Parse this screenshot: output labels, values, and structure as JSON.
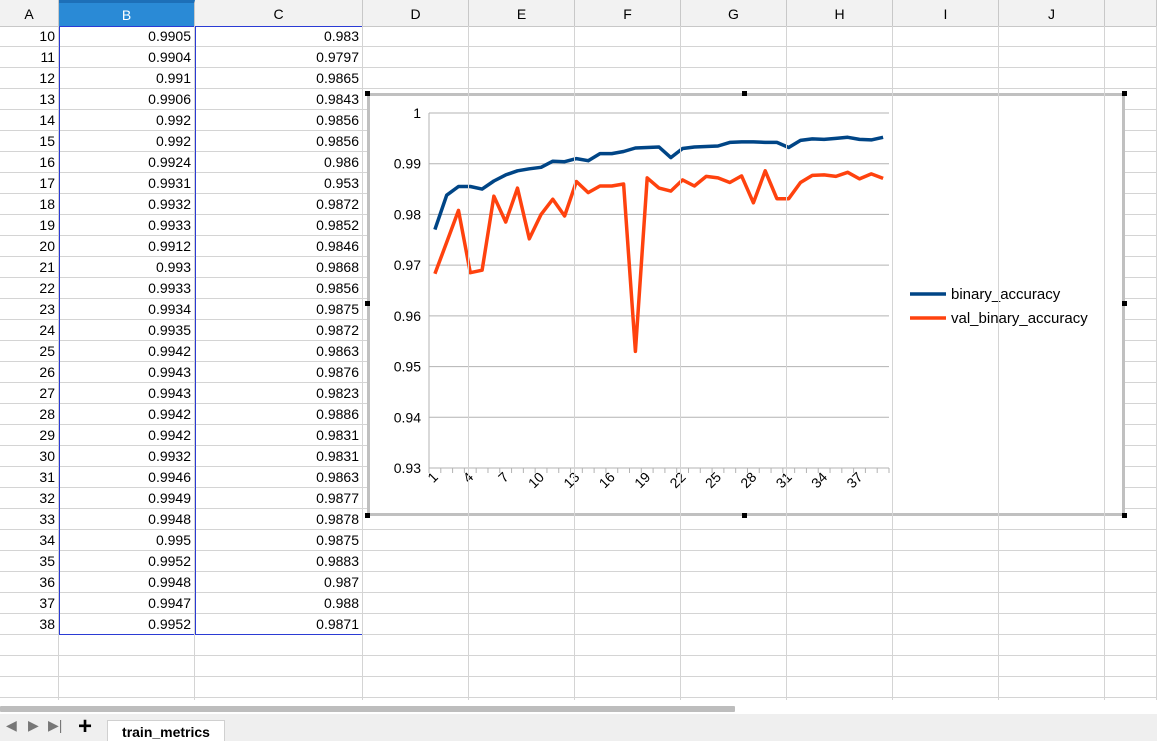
{
  "spreadsheet": {
    "columns": [
      "A",
      "B",
      "C",
      "D",
      "E",
      "F",
      "G",
      "H",
      "I",
      "J",
      ""
    ],
    "selected_column": "B",
    "rows": [
      {
        "a": "10",
        "b": "0.9905",
        "c": "0.983"
      },
      {
        "a": "11",
        "b": "0.9904",
        "c": "0.9797"
      },
      {
        "a": "12",
        "b": "0.991",
        "c": "0.9865"
      },
      {
        "a": "13",
        "b": "0.9906",
        "c": "0.9843"
      },
      {
        "a": "14",
        "b": "0.992",
        "c": "0.9856"
      },
      {
        "a": "15",
        "b": "0.992",
        "c": "0.9856"
      },
      {
        "a": "16",
        "b": "0.9924",
        "c": "0.986"
      },
      {
        "a": "17",
        "b": "0.9931",
        "c": "0.953"
      },
      {
        "a": "18",
        "b": "0.9932",
        "c": "0.9872"
      },
      {
        "a": "19",
        "b": "0.9933",
        "c": "0.9852"
      },
      {
        "a": "20",
        "b": "0.9912",
        "c": "0.9846"
      },
      {
        "a": "21",
        "b": "0.993",
        "c": "0.9868"
      },
      {
        "a": "22",
        "b": "0.9933",
        "c": "0.9856"
      },
      {
        "a": "23",
        "b": "0.9934",
        "c": "0.9875"
      },
      {
        "a": "24",
        "b": "0.9935",
        "c": "0.9872"
      },
      {
        "a": "25",
        "b": "0.9942",
        "c": "0.9863"
      },
      {
        "a": "26",
        "b": "0.9943",
        "c": "0.9876"
      },
      {
        "a": "27",
        "b": "0.9943",
        "c": "0.9823"
      },
      {
        "a": "28",
        "b": "0.9942",
        "c": "0.9886"
      },
      {
        "a": "29",
        "b": "0.9942",
        "c": "0.9831"
      },
      {
        "a": "30",
        "b": "0.9932",
        "c": "0.9831"
      },
      {
        "a": "31",
        "b": "0.9946",
        "c": "0.9863"
      },
      {
        "a": "32",
        "b": "0.9949",
        "c": "0.9877"
      },
      {
        "a": "33",
        "b": "0.9948",
        "c": "0.9878"
      },
      {
        "a": "34",
        "b": "0.995",
        "c": "0.9875"
      },
      {
        "a": "35",
        "b": "0.9952",
        "c": "0.9883"
      },
      {
        "a": "36",
        "b": "0.9948",
        "c": "0.987"
      },
      {
        "a": "37",
        "b": "0.9947",
        "c": "0.988"
      },
      {
        "a": "38",
        "b": "0.9952",
        "c": "0.9871"
      }
    ]
  },
  "chart_data": {
    "type": "line",
    "title": "",
    "xlabel": "",
    "ylabel": "",
    "x": [
      1,
      2,
      3,
      4,
      5,
      6,
      7,
      8,
      9,
      10,
      11,
      12,
      13,
      14,
      15,
      16,
      17,
      18,
      19,
      20,
      21,
      22,
      23,
      24,
      25,
      26,
      27,
      28,
      29,
      30,
      31,
      32,
      33,
      34,
      35,
      36,
      37,
      38,
      39
    ],
    "x_tick_labels": [
      "1",
      "4",
      "7",
      "10",
      "13",
      "16",
      "19",
      "22",
      "25",
      "28",
      "31",
      "34",
      "37"
    ],
    "y_tick_labels": [
      "0.93",
      "0.94",
      "0.95",
      "0.96",
      "0.97",
      "0.98",
      "0.99",
      "1"
    ],
    "ylim": [
      0.93,
      1.0
    ],
    "grid": true,
    "legend_position": "right",
    "series": [
      {
        "name": "binary_accuracy",
        "color": "#004586",
        "values": [
          0.977,
          0.9838,
          0.9855,
          0.9855,
          0.985,
          0.9866,
          0.9878,
          0.9886,
          0.989,
          0.9893,
          0.9905,
          0.9904,
          0.991,
          0.9906,
          0.992,
          0.992,
          0.9924,
          0.9931,
          0.9932,
          0.9933,
          0.9912,
          0.993,
          0.9933,
          0.9934,
          0.9935,
          0.9942,
          0.9943,
          0.9943,
          0.9942,
          0.9942,
          0.9932,
          0.9946,
          0.9949,
          0.9948,
          0.995,
          0.9952,
          0.9948,
          0.9947,
          0.9952
        ]
      },
      {
        "name": "val_binary_accuracy",
        "color": "#ff420e",
        "values": [
          0.9683,
          0.9745,
          0.9808,
          0.9685,
          0.969,
          0.9836,
          0.9785,
          0.9852,
          0.9752,
          0.98,
          0.983,
          0.9797,
          0.9865,
          0.9843,
          0.9856,
          0.9856,
          0.986,
          0.953,
          0.9872,
          0.9852,
          0.9846,
          0.9868,
          0.9856,
          0.9875,
          0.9872,
          0.9863,
          0.9876,
          0.9823,
          0.9886,
          0.9831,
          0.9831,
          0.9863,
          0.9877,
          0.9878,
          0.9875,
          0.9883,
          0.987,
          0.988,
          0.9871
        ]
      }
    ]
  },
  "tabs": {
    "sheet_name": "train_metrics",
    "add_label": "+",
    "nav": [
      "◀",
      "▶",
      "▶|"
    ]
  }
}
